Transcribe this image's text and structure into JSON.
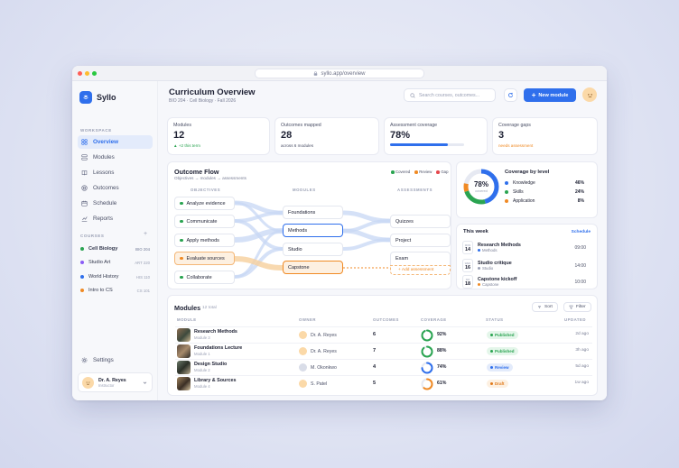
{
  "browser": {
    "url": "syllo.app/overview"
  },
  "app": {
    "name": "Syllo"
  },
  "sidebar": {
    "workspace_label": "WORKSPACE",
    "nav": [
      {
        "label": "Overview",
        "icon": "grid-icon"
      },
      {
        "label": "Modules",
        "icon": "modules-icon"
      },
      {
        "label": "Lessons",
        "icon": "book-icon"
      },
      {
        "label": "Outcomes",
        "icon": "target-icon"
      },
      {
        "label": "Schedule",
        "icon": "calendar-icon"
      },
      {
        "label": "Reports",
        "icon": "chart-icon"
      }
    ],
    "courses_label": "COURSES",
    "courses": [
      {
        "name": "Cell Biology",
        "code": "BIO 204",
        "color": "#2aa451"
      },
      {
        "name": "Studio Art",
        "code": "ART 220",
        "color": "#8b5cf6"
      },
      {
        "name": "World History",
        "code": "HIS 110",
        "color": "#2f6fec"
      },
      {
        "name": "Intro to CS",
        "code": "CS 101",
        "color": "#f08a24"
      }
    ],
    "settings": "Settings",
    "user": {
      "name": "Dr. A. Reyes",
      "role": "Instructor"
    }
  },
  "header": {
    "title": "Curriculum Overview",
    "subtitle": "BIO 204 · Cell Biology · Fall 2026",
    "search_placeholder": "Search courses, outcomes...",
    "new_button": "New module"
  },
  "stats": [
    {
      "label": "Modules",
      "value": "12",
      "note": "▲ +2 this term",
      "note_color": "#2aa451"
    },
    {
      "label": "Outcomes mapped",
      "value": "28",
      "note": "across 6 modules",
      "note_color": "#4a4f66"
    },
    {
      "label": "Assessment coverage",
      "value": "78%",
      "progress": 0.78
    },
    {
      "label": "Coverage gaps",
      "value": "3",
      "note": "needs assessment",
      "note_color": "#f08a24"
    }
  ],
  "flow": {
    "title": "Outcome Flow",
    "subtitle": "Objectives → modules → assessments",
    "legend": [
      {
        "label": "Covered",
        "color": "#2aa451"
      },
      {
        "label": "Review",
        "color": "#f08a24"
      },
      {
        "label": "Gap",
        "color": "#e5484d"
      }
    ],
    "col_objectives": "OBJECTIVES",
    "col_modules": "MODULES",
    "col_assessments": "ASSESSMENTS",
    "objectives": [
      "Analyze evidence",
      "Communicate",
      "Apply methods",
      "Evaluate sources",
      "Collaborate"
    ],
    "modules": [
      "Foundations",
      "Methods",
      "Studio",
      "Capstone"
    ],
    "assessments": [
      "Quizzes",
      "Project",
      "Exam"
    ],
    "add_assessment": "+ Add assessment"
  },
  "coverage": {
    "value": "78%",
    "value_label": "covered",
    "title": "Coverage by level",
    "levels": [
      {
        "label": "Knowledge",
        "pct": "46%",
        "color": "#2f6fec"
      },
      {
        "label": "Skills",
        "pct": "24%",
        "color": "#2aa451"
      },
      {
        "label": "Application",
        "pct": "8%",
        "color": "#f08a24"
      }
    ]
  },
  "week": {
    "title": "This week",
    "link": "Schedule",
    "items": [
      {
        "dow": "MON",
        "day": "14",
        "title": "Research Methods",
        "sub": "Methods",
        "time": "09:00",
        "color": "#2f6fec"
      },
      {
        "dow": "WED",
        "day": "16",
        "title": "Studio critique",
        "sub": "Studio",
        "time": "14:00",
        "color": "#9aa0b5"
      },
      {
        "dow": "FRI",
        "day": "18",
        "title": "Capstone kickoff",
        "sub": "Capstone",
        "time": "10:00",
        "color": "#f08a24"
      }
    ]
  },
  "modules_table": {
    "title": "Modules",
    "count": "12 total",
    "sort": "Sort",
    "filter": "Filter",
    "headers": [
      "MODULE",
      "OWNER",
      "OUTCOMES",
      "COVERAGE",
      "STATUS",
      "UPDATED"
    ],
    "rows": [
      {
        "name": "Research Methods",
        "sub": "Module 3",
        "owner": "Dr. A. Reyes",
        "outcomes": "6",
        "coverage": "92%",
        "coverage_value": 0.92,
        "ring_color": "#2aa451",
        "status": "Published",
        "status_color": "#2aa451",
        "status_bg": "#e4f6ea",
        "updated": "2d ago"
      },
      {
        "name": "Foundations Lecture",
        "sub": "Module 1",
        "owner": "Dr. A. Reyes",
        "outcomes": "7",
        "coverage": "88%",
        "coverage_value": 0.88,
        "ring_color": "#2aa451",
        "status": "Published",
        "status_color": "#2aa451",
        "status_bg": "#e4f6ea",
        "updated": "3h ago"
      },
      {
        "name": "Design Studio",
        "sub": "Module 2",
        "owner": "M. Okonkwo",
        "outcomes": "4",
        "coverage": "74%",
        "coverage_value": 0.74,
        "ring_color": "#2f6fec",
        "status": "Review",
        "status_color": "#2f6fec",
        "status_bg": "#e3ebfb",
        "updated": "5d ago"
      },
      {
        "name": "Library & Sources",
        "sub": "Module 4",
        "owner": "S. Patel",
        "outcomes": "5",
        "coverage": "61%",
        "coverage_value": 0.61,
        "ring_color": "#f08a24",
        "status": "Draft",
        "status_color": "#e0791a",
        "status_bg": "#fdf0e1",
        "updated": "1w ago"
      }
    ]
  }
}
